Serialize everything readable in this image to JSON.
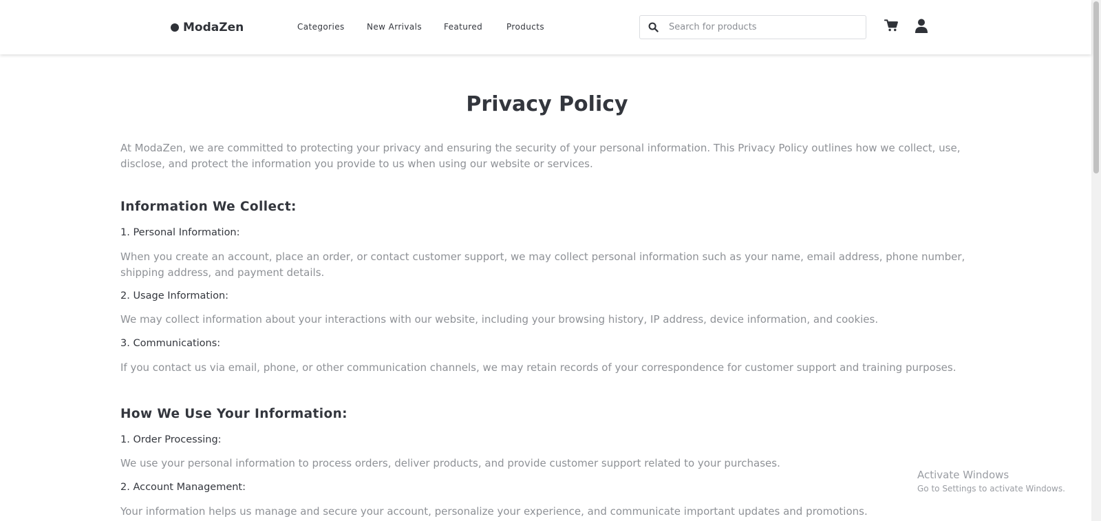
{
  "header": {
    "logo_text": "ModaZen",
    "nav": [
      "Categories",
      "New Arrivals",
      "Featured",
      "Products"
    ],
    "search": {
      "placeholder": "Search for products",
      "value": ""
    }
  },
  "page": {
    "title": "Privacy Policy",
    "intro": "At ModaZen, we are committed to protecting your privacy and ensuring the security of your personal information. This Privacy Policy outlines how we collect, use, disclose, and protect the information you provide to us when using our website or services.",
    "sections": [
      {
        "title": "Information We Collect:",
        "items": [
          {
            "title": "1. Personal Information:",
            "text": "When you create an account, place an order, or contact customer support, we may collect personal information such as your name, email address, phone number, shipping address, and payment details."
          },
          {
            "title": "2. Usage Information:",
            "text": "We may collect information about your interactions with our website, including your browsing history, IP address, device information, and cookies."
          },
          {
            "title": "3. Communications:",
            "text": "If you contact us via email, phone, or other communication channels, we may retain records of your correspondence for customer support and training purposes."
          }
        ]
      },
      {
        "title": "How We Use Your Information:",
        "items": [
          {
            "title": "1. Order Processing:",
            "text": "We use your personal information to process orders, deliver products, and provide customer support related to your purchases."
          },
          {
            "title": "2. Account Management:",
            "text": "Your information helps us manage and secure your account, personalize your experience, and communicate important updates and promotions."
          }
        ]
      }
    ]
  },
  "watermark": {
    "line1": "Activate Windows",
    "line2": "Go to Settings to activate Windows."
  },
  "icons": {
    "logo": "logo-icon",
    "search": "search-icon",
    "cart": "cart-icon",
    "user": "user-icon"
  }
}
